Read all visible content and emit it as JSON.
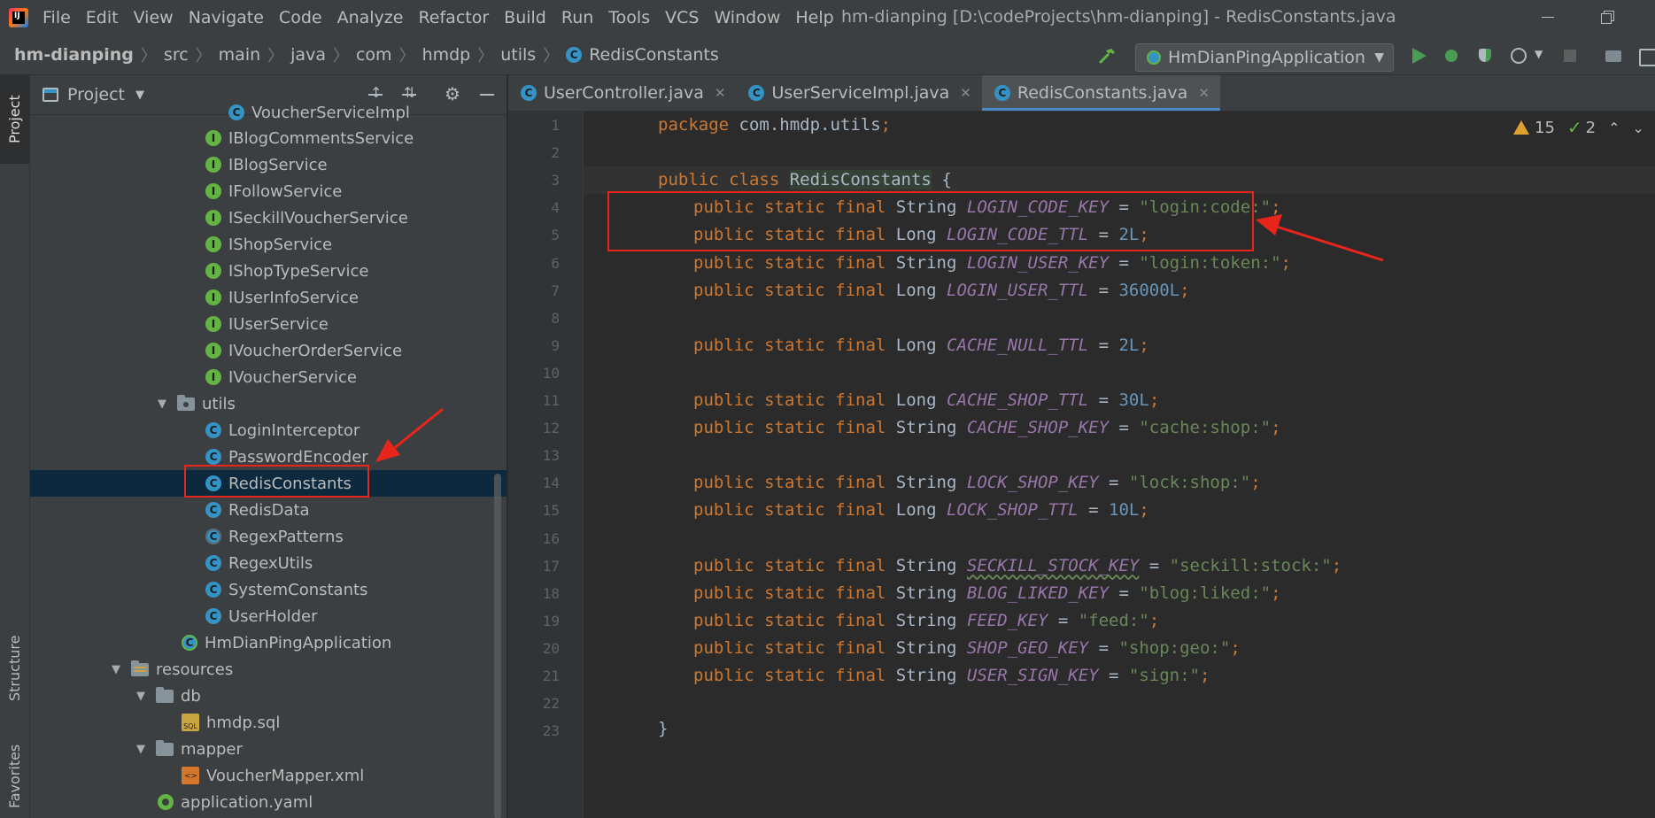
{
  "menu": {
    "items": [
      "File",
      "Edit",
      "View",
      "Navigate",
      "Code",
      "Analyze",
      "Refactor",
      "Build",
      "Run",
      "Tools",
      "VCS",
      "Window",
      "Help"
    ],
    "window_title": "hm-dianping [D:\\codeProjects\\hm-dianping] - RedisConstants.java"
  },
  "breadcrumb": {
    "project": "hm-dianping",
    "parts": [
      "src",
      "main",
      "java",
      "com",
      "hmdp",
      "utils"
    ],
    "file": "RedisConstants"
  },
  "run_config": {
    "name": "HmDianPingApplication"
  },
  "project_panel": {
    "title": "Project",
    "tree": [
      {
        "label": "VoucherServiceImpl",
        "icon": "class"
      },
      {
        "label": "IBlogCommentsService",
        "icon": "interface"
      },
      {
        "label": "IBlogService",
        "icon": "interface"
      },
      {
        "label": "IFollowService",
        "icon": "interface"
      },
      {
        "label": "ISeckillVoucherService",
        "icon": "interface"
      },
      {
        "label": "IShopService",
        "icon": "interface"
      },
      {
        "label": "IShopTypeService",
        "icon": "interface"
      },
      {
        "label": "IUserInfoService",
        "icon": "interface"
      },
      {
        "label": "IUserService",
        "icon": "interface"
      },
      {
        "label": "IVoucherOrderService",
        "icon": "interface"
      },
      {
        "label": "IVoucherService",
        "icon": "interface"
      },
      {
        "label": "utils",
        "icon": "package"
      },
      {
        "label": "LoginInterceptor",
        "icon": "class"
      },
      {
        "label": "PasswordEncoder",
        "icon": "class"
      },
      {
        "label": "RedisConstants",
        "icon": "class"
      },
      {
        "label": "RedisData",
        "icon": "class"
      },
      {
        "label": "RegexPatterns",
        "icon": "abstract"
      },
      {
        "label": "RegexUtils",
        "icon": "class"
      },
      {
        "label": "SystemConstants",
        "icon": "class"
      },
      {
        "label": "UserHolder",
        "icon": "class"
      },
      {
        "label": "HmDianPingApplication",
        "icon": "app"
      },
      {
        "label": "resources",
        "icon": "resources"
      },
      {
        "label": "db",
        "icon": "folder"
      },
      {
        "label": "hmdp.sql",
        "icon": "sql"
      },
      {
        "label": "mapper",
        "icon": "folder"
      },
      {
        "label": "VoucherMapper.xml",
        "icon": "xml"
      },
      {
        "label": "application.yaml",
        "icon": "yaml"
      }
    ],
    "sql_badge": "SQL"
  },
  "left_strip": {
    "project": "Project",
    "structure": "Structure",
    "favorites": "Favorites"
  },
  "tabs": [
    {
      "label": "UserController.java"
    },
    {
      "label": "UserServiceImpl.java"
    },
    {
      "label": "RedisConstants.java"
    }
  ],
  "inspection": {
    "warnings": "15",
    "checks": "2"
  },
  "editor": {
    "line_numbers": [
      "1",
      "2",
      "3",
      "4",
      "5",
      "6",
      "7",
      "8",
      "9",
      "10",
      "11",
      "12",
      "13",
      "14",
      "15",
      "16",
      "17",
      "18",
      "19",
      "20",
      "21",
      "22",
      "23"
    ],
    "package_decl": "com.hmdp.utils",
    "class_name": "RedisConstants",
    "fields": [
      {
        "line": 4,
        "type": "String",
        "name": "LOGIN_CODE_KEY",
        "value": "\"login:code:\""
      },
      {
        "line": 5,
        "type": "Long",
        "name": "LOGIN_CODE_TTL",
        "value": "2L"
      },
      {
        "line": 6,
        "type": "String",
        "name": "LOGIN_USER_KEY",
        "value": "\"login:token:\""
      },
      {
        "line": 7,
        "type": "Long",
        "name": "LOGIN_USER_TTL",
        "value": "36000L"
      },
      {
        "line": 9,
        "type": "Long",
        "name": "CACHE_NULL_TTL",
        "value": "2L"
      },
      {
        "line": 11,
        "type": "Long",
        "name": "CACHE_SHOP_TTL",
        "value": "30L"
      },
      {
        "line": 12,
        "type": "String",
        "name": "CACHE_SHOP_KEY",
        "value": "\"cache:shop:\""
      },
      {
        "line": 14,
        "type": "String",
        "name": "LOCK_SHOP_KEY",
        "value": "\"lock:shop:\""
      },
      {
        "line": 15,
        "type": "Long",
        "name": "LOCK_SHOP_TTL",
        "value": "10L"
      },
      {
        "line": 17,
        "type": "String",
        "name": "SECKILL_STOCK_KEY",
        "value": "\"seckill:stock:\""
      },
      {
        "line": 18,
        "type": "String",
        "name": "BLOG_LIKED_KEY",
        "value": "\"blog:liked:\""
      },
      {
        "line": 19,
        "type": "String",
        "name": "FEED_KEY",
        "value": "\"feed:\""
      },
      {
        "line": 20,
        "type": "String",
        "name": "SHOP_GEO_KEY",
        "value": "\"shop:geo:\""
      },
      {
        "line": 21,
        "type": "String",
        "name": "USER_SIGN_KEY",
        "value": "\"sign:\""
      }
    ]
  },
  "colors": {
    "accent": "#4a88c7",
    "annotation": "#e8251b",
    "selection": "#0d293e"
  }
}
